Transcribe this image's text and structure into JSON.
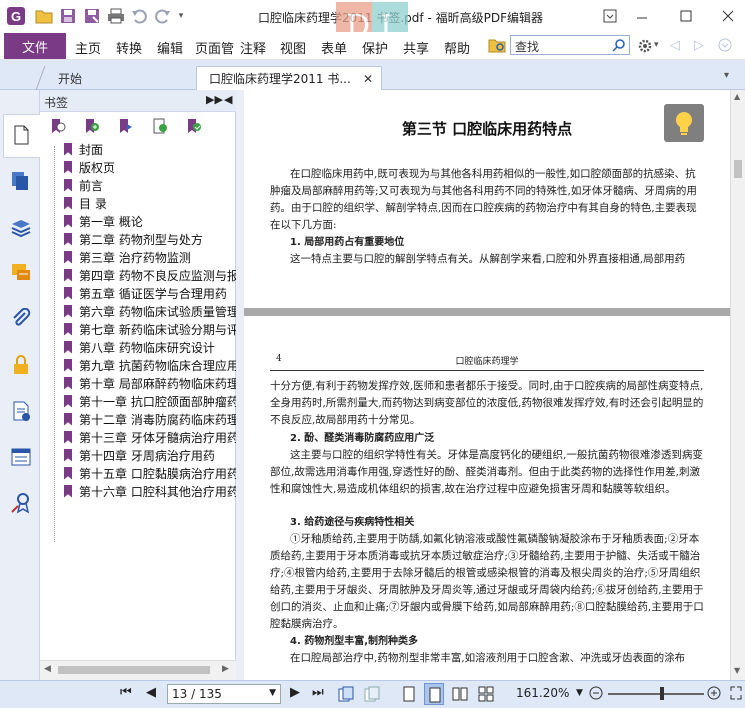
{
  "window": {
    "title": "口腔临床药理学2011 书签.pdf - 福昕高级PDF编辑器"
  },
  "ribbon": {
    "file": "文件",
    "tabs": [
      "主页",
      "转换",
      "编辑",
      "页面管",
      "注释",
      "视图",
      "表单",
      "保护",
      "共享",
      "帮助"
    ],
    "search_placeholder": "查找"
  },
  "doc_tabs": {
    "home": "开始",
    "doc": "口腔临床药理学2011 书..."
  },
  "bookmarks": {
    "header": "书签",
    "items": [
      "封面",
      "版权页",
      "前言",
      "目  录",
      "第一章  概论",
      "第二章  药物剂型与处方",
      "第三章  治疗药物监测",
      "第四章  药物不良反应监测与报",
      "第五章  循证医学与合理用药",
      "第六章  药物临床试验质量管理",
      "第七章  新药临床试验分期与评",
      "第八章  药物临床研究设计",
      "第九章  抗菌药物临床合理应用",
      "第十章  局部麻醉药物临床药理",
      "第十一章  抗口腔颌面部肿瘤药",
      "第十二章  消毒防腐药临床药理",
      "第十三章  牙体牙髓病治疗用药",
      "第十四章  牙周病治疗用药",
      "第十五章  口腔黏膜病治疗用药",
      "第十六章  口腔科其他治疗用药"
    ]
  },
  "page1": {
    "heading": "第三节   口腔临床用药特点",
    "para1": "在口腔临床用药中,既可表现为与其他各科用药相似的一般性,如口腔颌面部的抗感染、抗肿瘤及局部麻醉用药等;又可表现为与其他各科用药不同的特殊性,如牙体牙髓病、牙周病的用药。由于口腔的组织学、解剖学特点,因而在口腔疾病的药物治疗中有其自身的特色,主要表现在以下几方面:",
    "h1": "1. 局部用药占有重要地位",
    "para2": "这一特点主要与口腔的解剖学特点有关。从解剖学来看,口腔和外界直接相通,局部用药"
  },
  "page2": {
    "page_no": "4",
    "running_head": "口腔临床药理学",
    "para1": "十分方便,有利于药物发挥疗效,医师和患者都乐于接受。同时,由于口腔疾病的局部性病变特点,全身用药时,所需剂量大,而药物达到病变部位的浓度低,药物很难发挥疗效,有时还会引起明显的不良反应,故局部用药十分常见。",
    "h2": "2. 酚、醛类消毒防腐药应用广泛",
    "para2": "这主要与口腔的组织学特性有关。牙体是高度钙化的硬组织,一般抗菌药物很难渗透到病变部位,故需选用消毒作用强,穿透性好的酚、醛类消毒剂。但由于此类药物的选择性作用差,刺激性和腐蚀性大,易造成机体组织的损害,故在治疗过程中应避免损害牙周和黏膜等软组织。",
    "h3": "3. 给药途径与疾病特性相关",
    "para3": "①牙釉质给药,主要用于防龋,如氟化钠溶液或酸性氟磷酸钠凝胶涂布于牙釉质表面;②牙本质给药,主要用于牙本质消毒或抗牙本质过敏症治疗;③牙髓给药,主要用于护髓、失活或干髓治疗;④根管内给药,主要用于去除牙髓后的根管或感染根管的消毒及根尖周炎的治疗;⑤牙周组织给药,主要用于牙龈炎、牙周脓肿及牙周炎等,通过牙龈或牙周袋内给药;⑥拔牙创给药,主要用于创口的消炎、止血和止痛;⑦牙龈内或骨膜下给药,如局部麻醉用药;⑧口腔黏膜给药,主要用于口腔黏膜病治疗。",
    "h4": "4. 药物剂型丰富,制剂种类多",
    "para4": "在口腔局部治疗中,药物剂型非常丰富,如溶液剂用于口腔含漱、冲洗或牙齿表面的涂布"
  },
  "status": {
    "page": "13 / 135",
    "zoom": "161.20%"
  }
}
